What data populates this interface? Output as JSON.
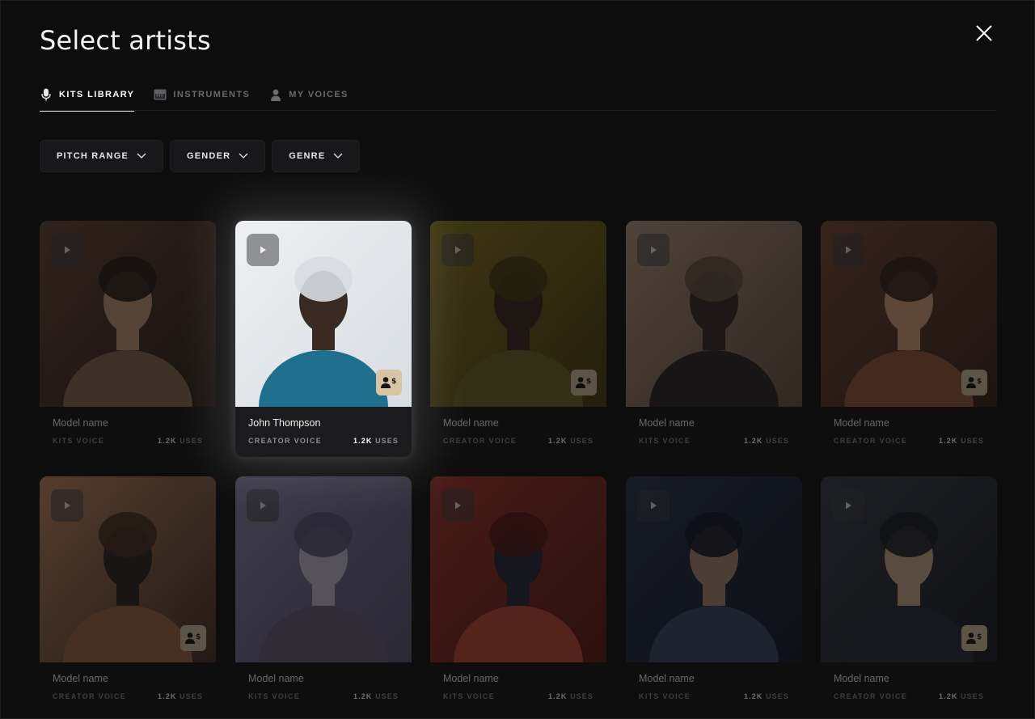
{
  "modal": {
    "title": "Select artists",
    "close_icon": "close-icon"
  },
  "tabs": [
    {
      "label": "KITS LIBRARY",
      "icon": "microphone-icon",
      "active": true
    },
    {
      "label": "INSTRUMENTS",
      "icon": "piano-icon",
      "active": false
    },
    {
      "label": "MY VOICES",
      "icon": "user-icon",
      "active": false
    }
  ],
  "filters": [
    {
      "label": "PITCH RANGE",
      "icon": "chevron-down-icon"
    },
    {
      "label": "GENDER",
      "icon": "chevron-down-icon"
    },
    {
      "label": "GENRE",
      "icon": "chevron-down-icon"
    }
  ],
  "artists": [
    {
      "name": "Model name",
      "type": "KITS VOICE",
      "uses_count": "1.2K",
      "uses_label": "USES",
      "has_badge": false
    },
    {
      "name": "John Thompson",
      "type": "CREATOR VOICE",
      "uses_count": "1.2K",
      "uses_label": "USES",
      "has_badge": true,
      "selected": true
    },
    {
      "name": "Model name",
      "type": "CREATOR VOICE",
      "uses_count": "1.2K",
      "uses_label": "USES",
      "has_badge": true
    },
    {
      "name": "Model name",
      "type": "KITS VOICE",
      "uses_count": "1.2K",
      "uses_label": "USES",
      "has_badge": false
    },
    {
      "name": "Model name",
      "type": "CREATOR VOICE",
      "uses_count": "1.2K",
      "uses_label": "USES",
      "has_badge": true
    },
    {
      "name": "Model name",
      "type": "CREATOR VOICE",
      "uses_count": "1.2K",
      "uses_label": "USES",
      "has_badge": true
    },
    {
      "name": "Model name",
      "type": "KITS VOICE",
      "uses_count": "1.2K",
      "uses_label": "USES",
      "has_badge": false
    },
    {
      "name": "Model name",
      "type": "KITS VOICE",
      "uses_count": "1.2K",
      "uses_label": "USES",
      "has_badge": false
    },
    {
      "name": "Model name",
      "type": "KITS VOICE",
      "uses_count": "1.2K",
      "uses_label": "USES",
      "has_badge": false
    },
    {
      "name": "Model name",
      "type": "CREATOR VOICE",
      "uses_count": "1.2K",
      "uses_label": "USES",
      "has_badge": true
    }
  ],
  "colors": {
    "background": "#0d0d0e",
    "card": "#141416",
    "badge": "#d9c4a4",
    "accent_text": "#ffffff",
    "muted_text": "#8d8d92"
  }
}
